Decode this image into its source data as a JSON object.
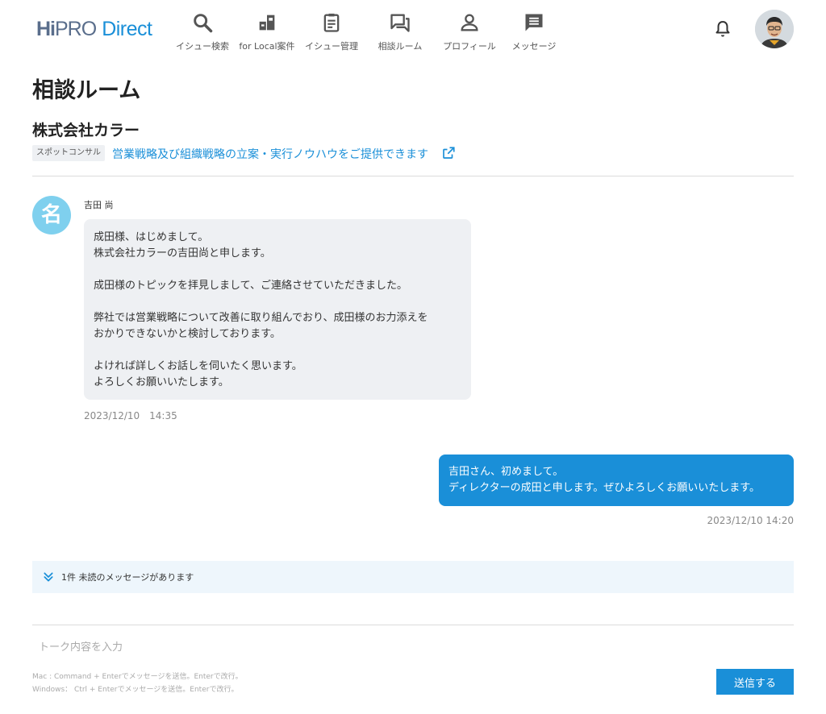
{
  "header": {
    "logo": {
      "hi": "Hi",
      "pro": "PRO",
      "direct": "Direct"
    },
    "nav": [
      {
        "label": "イシュー検索",
        "icon": "search-icon"
      },
      {
        "label": "for Local案件",
        "icon": "local-icon"
      },
      {
        "label": "イシュー管理",
        "icon": "clipboard-icon"
      },
      {
        "label": "相談ルーム",
        "icon": "chat-icon"
      },
      {
        "label": "プロフィール",
        "icon": "person-icon"
      },
      {
        "label": "メッセージ",
        "icon": "message-icon"
      }
    ],
    "notification_icon": "bell-icon",
    "avatar_icon": "user-avatar"
  },
  "page": {
    "title": "相談ルーム",
    "company": "株式会社カラー",
    "tag": "スポットコンサル",
    "topic": "営業戦略及び組織戦略の立案・実行ノウハウをご提供できます"
  },
  "messages": {
    "incoming": {
      "avatar_char": "名",
      "sender": "吉田 尚",
      "lines": [
        "成田様、はじめまして。",
        "株式会社カラーの吉田尚と申します。",
        "",
        "成田様のトピックを拝見しまして、ご連絡させていただきました。",
        "",
        "弊社では営業戦略について改善に取り組んでおり、成田様のお力添えを",
        "おかりできないかと検討しております。",
        "",
        "よければ詳しくお話しを伺いたく思います。",
        "よろしくお願いいたします。"
      ],
      "time": "2023/12/10　14:35"
    },
    "outgoing": {
      "lines": [
        "吉田さん、初めまして。",
        "ディレクターの成田と申します。ぜひよろしくお願いいたします。"
      ],
      "time": "2023/12/10 14:20"
    },
    "unread": "1件 未読のメッセージがあります"
  },
  "composer": {
    "placeholder": "トーク内容を入力",
    "hint_mac": "Mac : Command + Enterでメッセージを送信。Enterで改行。",
    "hint_win": "Windows： Ctrl + Enterでメッセージを送信。Enterで改行。",
    "send_label": "送信する"
  },
  "colors": {
    "accent": "#1a8fd8",
    "bubble_in": "#eef0f3",
    "avatar_bg": "#7fd0ee",
    "unread_bg": "#eef6fc"
  }
}
